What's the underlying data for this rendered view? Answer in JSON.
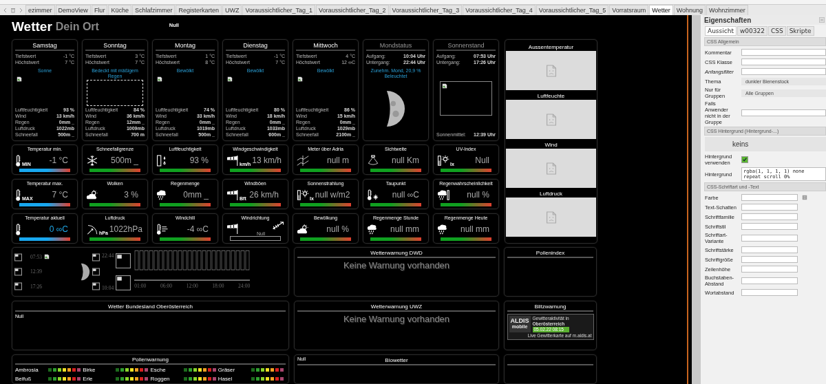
{
  "tabs": [
    {
      "label": "ezimmer",
      "selected": false
    },
    {
      "label": "DemoView",
      "selected": false
    },
    {
      "label": "Flur",
      "selected": false
    },
    {
      "label": "Küche",
      "selected": false
    },
    {
      "label": "Schlafzimmer",
      "selected": false
    },
    {
      "label": "Registerkarten",
      "selected": false
    },
    {
      "label": "UWZ",
      "selected": false
    },
    {
      "label": "Voraussichtlicher_Tag_1",
      "selected": false
    },
    {
      "label": "Voraussichtlicher_Tag_2",
      "selected": false
    },
    {
      "label": "Voraussichtlicher_Tag_3",
      "selected": false
    },
    {
      "label": "Voraussichtlicher_Tag_4",
      "selected": false
    },
    {
      "label": "Voraussichtlicher_Tag_5",
      "selected": false
    },
    {
      "label": "Vorratsraum",
      "selected": false
    },
    {
      "label": "Wetter",
      "selected": true
    },
    {
      "label": "Wohnung",
      "selected": false
    },
    {
      "label": "Wohnzimmer",
      "selected": false
    }
  ],
  "header": {
    "title": "Wetter",
    "subtitle": "Dein Ort",
    "status": "Null"
  },
  "days": [
    {
      "name": "Samstag",
      "selected": false,
      "rows": [
        {
          "label": "Tiefstwert",
          "value": "-1 °C"
        },
        {
          "label": "Höchstwert",
          "value": "7 °C"
        }
      ],
      "condition": "Sonne",
      "stats": [
        {
          "label": "Luftfeuchtigkeit",
          "value": "93 %"
        },
        {
          "label": "Wind",
          "value": "13 km/h"
        },
        {
          "label": "Regen",
          "value": "0mm _"
        },
        {
          "label": "Luftdruck",
          "value": "1022mb"
        },
        {
          "label": "Schneefall",
          "value": "500m _"
        }
      ]
    },
    {
      "name": "Sonntag",
      "selected": true,
      "rows": [
        {
          "label": "Tiefstwert",
          "value": "3 °C"
        },
        {
          "label": "Höchstwert",
          "value": "7 °C"
        }
      ],
      "condition": "Bedeckt mit mäßigem Regen",
      "stats": [
        {
          "label": "Luftfeuchtigkeit",
          "value": "84 %"
        },
        {
          "label": "Wind",
          "value": "36 km/h"
        },
        {
          "label": "Regen",
          "value": "12mm _"
        },
        {
          "label": "Luftdruck",
          "value": "1009mb"
        },
        {
          "label": "Schneefall",
          "value": "700 m"
        }
      ]
    },
    {
      "name": "Montag",
      "selected": false,
      "rows": [
        {
          "label": "Tiefstwert",
          "value": "1 °C"
        },
        {
          "label": "Höchstwert",
          "value": "8 °C"
        }
      ],
      "condition": "Bewölkt",
      "stats": [
        {
          "label": "Luftfeuchtigkeit",
          "value": "74 %"
        },
        {
          "label": "Wind",
          "value": "33 km/h"
        },
        {
          "label": "Regen",
          "value": "0mm _"
        },
        {
          "label": "Luftdruck",
          "value": "1019mb"
        },
        {
          "label": "Schneefall",
          "value": "500m _"
        }
      ]
    },
    {
      "name": "Dienstag",
      "selected": false,
      "rows": [
        {
          "label": "Tiefstwert",
          "value": "-1 °C"
        },
        {
          "label": "Höchstwert",
          "value": "7 °C"
        }
      ],
      "condition": "Bewölkt",
      "stats": [
        {
          "label": "Luftfeuchtigkeit",
          "value": "80 %"
        },
        {
          "label": "Wind",
          "value": "18 km/h"
        },
        {
          "label": "Regen",
          "value": "0mm _"
        },
        {
          "label": "Luftdruck",
          "value": "1033mb"
        },
        {
          "label": "Schneefall",
          "value": "600m _"
        }
      ]
    },
    {
      "name": "Mittwoch",
      "selected": false,
      "rows": [
        {
          "label": "Tiefstwert",
          "value": "4 °C"
        },
        {
          "label": "Höchstwert",
          "value": "12 ∞C"
        }
      ],
      "condition": "Bewölkt",
      "stats": [
        {
          "label": "Luftfeuchtigkeit",
          "value": "86 %"
        },
        {
          "label": "Wind",
          "value": "15 km/h"
        },
        {
          "label": "Regen",
          "value": "0mm _"
        },
        {
          "label": "Luftdruck",
          "value": "1029mb"
        },
        {
          "label": "Schneefall",
          "value": "2100m _"
        }
      ]
    }
  ],
  "moon": {
    "title": "Mondstatus",
    "rows": [
      {
        "label": "Aufgang:",
        "value": "10:04 Uhr"
      },
      {
        "label": "Untergang:",
        "value": "22:44 Uhr"
      }
    ],
    "phase": "Zunehm. Mond, 20,9 % Beleuchtet"
  },
  "sun": {
    "title": "Sonnenstand",
    "rows": [
      {
        "label": "Aufgang:",
        "value": "07:53 Uhr"
      },
      {
        "label": "Untergang:",
        "value": "17:26 Uhr"
      }
    ],
    "noon_label": "Sonnenmittel:",
    "noon": "12:39 Uhr"
  },
  "charts": [
    {
      "title": "Aussentemperatur"
    },
    {
      "title": "Luftfeuchte"
    },
    {
      "title": "Wind"
    },
    {
      "title": "Luftdruck"
    }
  ],
  "tiles": [
    {
      "title": "Temperatur min.",
      "value": "-1 °C",
      "kind": "temp",
      "icon_label": "MIN",
      "highlight": false
    },
    {
      "title": "Schneefallgrenze",
      "value": "500m _",
      "kind": "snow",
      "highlight": false
    },
    {
      "title": "Luftfeuchtigkeit",
      "value": "93 %",
      "kind": "humidity",
      "highlight": false
    },
    {
      "title": "Windgeschwindigkeit",
      "value": "13 km/h",
      "kind": "wind",
      "icon_label": "km/h",
      "highlight": false
    },
    {
      "title": "Meter über Adria",
      "value": "null m",
      "kind": "altitude",
      "highlight": false
    },
    {
      "title": "Sichtweite",
      "value": "null Km",
      "kind": "visibility",
      "highlight": false
    },
    {
      "title": "UV-Index",
      "value": "Null",
      "kind": "uv",
      "icon_label": "lx",
      "highlight": false
    },
    {
      "title": "Temperatur max.",
      "value": "7 °C",
      "kind": "temp",
      "icon_label": "MAX",
      "highlight": false
    },
    {
      "title": "Wolken",
      "value": "3 %",
      "kind": "clouds",
      "highlight": false
    },
    {
      "title": "Regenmenge",
      "value": "0mm _",
      "kind": "rain",
      "highlight": false
    },
    {
      "title": "Windböen",
      "value": "26 km/h",
      "kind": "wind",
      "icon_label": "Bft",
      "highlight": false
    },
    {
      "title": "Sonnenstrahlung",
      "value": "null w/m2",
      "kind": "uv",
      "icon_label": "lx",
      "highlight": false
    },
    {
      "title": "Taupunkt",
      "value": "null ∞C",
      "kind": "dewpoint",
      "highlight": false
    },
    {
      "title": "Regenwahrscheinlichkeit",
      "value": "null %",
      "kind": "rainprob",
      "highlight": false
    },
    {
      "title": "Temperatur aktuell",
      "value": "0 ∞C",
      "kind": "temp",
      "highlight": true
    },
    {
      "title": "Luftdruck",
      "value": "1022hPa",
      "kind": "gauge",
      "icon_label": "hPa",
      "highlight": false
    },
    {
      "title": "Windchill",
      "value": "-4 ∞C",
      "kind": "windchill",
      "highlight": false
    },
    {
      "title": "Windrichtung",
      "value": "Null",
      "kind": "direction",
      "highlight": false
    },
    {
      "title": "Bewölkung",
      "value": "null %",
      "kind": "clouds",
      "highlight": false
    },
    {
      "title": "Regenmenge Stunde",
      "value": "null mm",
      "kind": "rain",
      "highlight": false
    },
    {
      "title": "Regenmenge Heute",
      "value": "null mm",
      "kind": "rain",
      "highlight": false
    }
  ],
  "astro": {
    "left_times": [
      "07:53",
      "12:39",
      "17:26"
    ],
    "right_times": [
      "22:44",
      "10:04"
    ],
    "hours": [
      "01:00",
      "06:00",
      "12:00",
      "18:00",
      "24:00"
    ]
  },
  "dwd": {
    "title": "Wetterwarnung DWD",
    "message": "Keine Warnung vorhanden"
  },
  "pollen_index": {
    "title": "Pollenindex"
  },
  "region": {
    "title": "Wetter Bundesland Oberösterreich",
    "text": "Null"
  },
  "uwz": {
    "title": "Wetterwarnung UWZ",
    "message": "Keine Warnung vorhanden"
  },
  "lightning": {
    "title": "Blitzwarnung",
    "brand": "ALDIS",
    "brand_sub": "mobile",
    "line1": "Gewitteraktivität in",
    "region": "Oberösterreich",
    "time": "05.02.22 08:15",
    "footer": "Live Gewitterkarte auf m.aldis.at"
  },
  "pollen": {
    "title": "Pollenwarnung",
    "plants": [
      "Ambrosia",
      "Birke",
      "Esche",
      "Gräser",
      "Beifuß",
      "Erle",
      "Roggen",
      "Hasel"
    ],
    "scale": [
      {
        "color": "#1d6b1d"
      },
      {
        "color": "#2f9f2f"
      },
      {
        "color": "#8ad62a"
      },
      {
        "color": "#f0e024"
      },
      {
        "color": "#f0a022"
      },
      {
        "color": "#d82020"
      },
      {
        "color": "#a8456e"
      }
    ]
  },
  "bio": {
    "title": "Biowetter",
    "status": "Null"
  },
  "properties": {
    "title": "Eigenschaften",
    "tabs": [
      {
        "label": "Aussicht",
        "selected": true
      },
      {
        "label": "w00322",
        "selected": false
      },
      {
        "label": "CSS",
        "selected": false
      },
      {
        "label": "Skripte",
        "selected": false
      }
    ],
    "sections": [
      {
        "title": "CSS Allgemein",
        "rows": [
          {
            "kind": "input",
            "label": "Kommentar"
          },
          {
            "kind": "input",
            "label": "CSS Klasse"
          },
          {
            "kind": "filter",
            "label": "Anfangsfilter"
          },
          {
            "kind": "select",
            "label": "Thema",
            "value": "dunkler Bienenstock"
          },
          {
            "kind": "select",
            "label": "Nur für Gruppen",
            "value": "Alle Gruppen"
          },
          {
            "kind": "input",
            "label": "Falls Anwender nicht in der Gruppe"
          }
        ]
      },
      {
        "title": "CSS Hintergrund (Hintergrund-...)",
        "rows": [
          {
            "kind": "bigselect",
            "value": "keins"
          },
          {
            "kind": "checkbox",
            "label": "Hintergrund verwenden",
            "checked": true
          },
          {
            "kind": "text",
            "label": "Hintergrund",
            "value": "rgba(1, 1, 1, 1) none repeat scroll 0%"
          }
        ]
      },
      {
        "title": "CSS-Schriftart und -Text",
        "rows": [
          {
            "kind": "color",
            "label": "Farbe"
          },
          {
            "kind": "input",
            "label": "Text-Schatten"
          },
          {
            "kind": "input",
            "label": "Schriftfamilie"
          },
          {
            "kind": "input",
            "label": "Schriftstil"
          },
          {
            "kind": "input",
            "label": "Schriftart-Variante"
          },
          {
            "kind": "input",
            "label": "Schriftstärke"
          },
          {
            "kind": "input",
            "label": "Schriftgröße"
          },
          {
            "kind": "input",
            "label": "Zeilenhöhe"
          },
          {
            "kind": "input",
            "label": "Buchstaben-Abstand"
          },
          {
            "kind": "input",
            "label": "Wortabstand"
          }
        ]
      }
    ]
  }
}
